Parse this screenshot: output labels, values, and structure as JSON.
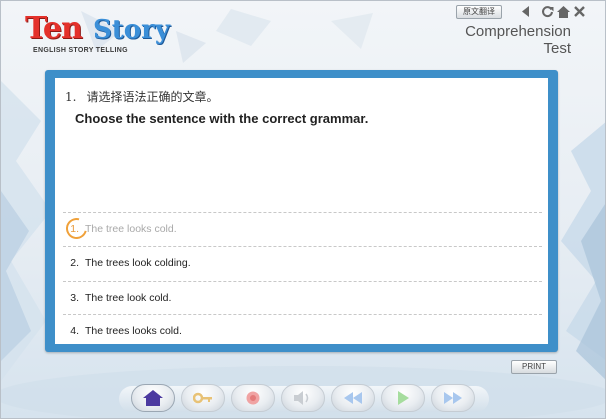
{
  "logo": {
    "part1": "Ten",
    "part2": "Story",
    "tagline": "ENGLISH STORY TELLING"
  },
  "header": {
    "translate_label": "原文翻译",
    "title_line1": "Comprehension",
    "title_line2": "Test",
    "icons": [
      "speaker-icon",
      "refresh-icon",
      "home-icon",
      "close-icon"
    ]
  },
  "question": {
    "number": "1.",
    "instruction_cn": "请选择语法正确的文章。",
    "instruction_en": "Choose the sentence with the correct grammar."
  },
  "options": [
    {
      "num": "1.",
      "text": "The tree looks cold.",
      "selected": true
    },
    {
      "num": "2.",
      "text": "The trees look colding.",
      "selected": false
    },
    {
      "num": "3.",
      "text": "The tree look cold.",
      "selected": false
    },
    {
      "num": "4.",
      "text": "The trees looks cold.",
      "selected": false
    }
  ],
  "print_label": "PRINT",
  "toolbar": {
    "buttons": [
      "home-icon",
      "key-icon",
      "record-icon",
      "volume-icon",
      "rewind-icon",
      "play-icon",
      "fast-forward-icon"
    ]
  },
  "colors": {
    "card_frame": "#3e8fc9",
    "selected_ring": "#f0a13a",
    "logo_red": "#e4312b",
    "logo_blue": "#3b8fd8"
  }
}
